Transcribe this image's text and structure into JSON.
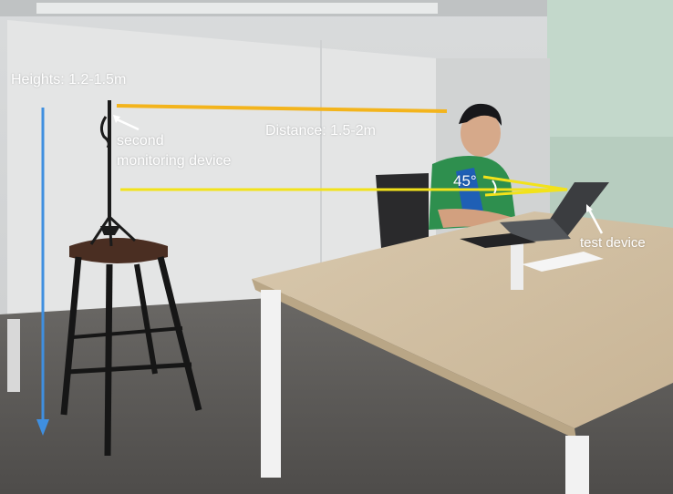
{
  "annotations": {
    "height_label": "Heights: 1.2-1.5m",
    "second_device_line1": "second",
    "second_device_line2": "monitoring device",
    "distance_label": "Distance: 1.5-2m",
    "angle_label": "45°",
    "test_device_label": "test device"
  },
  "colors": {
    "height_arrow": "#3f8fe0",
    "distance_line": "#f3b41c",
    "sight_line": "#f2e21a",
    "label_text": "#ffffff"
  }
}
